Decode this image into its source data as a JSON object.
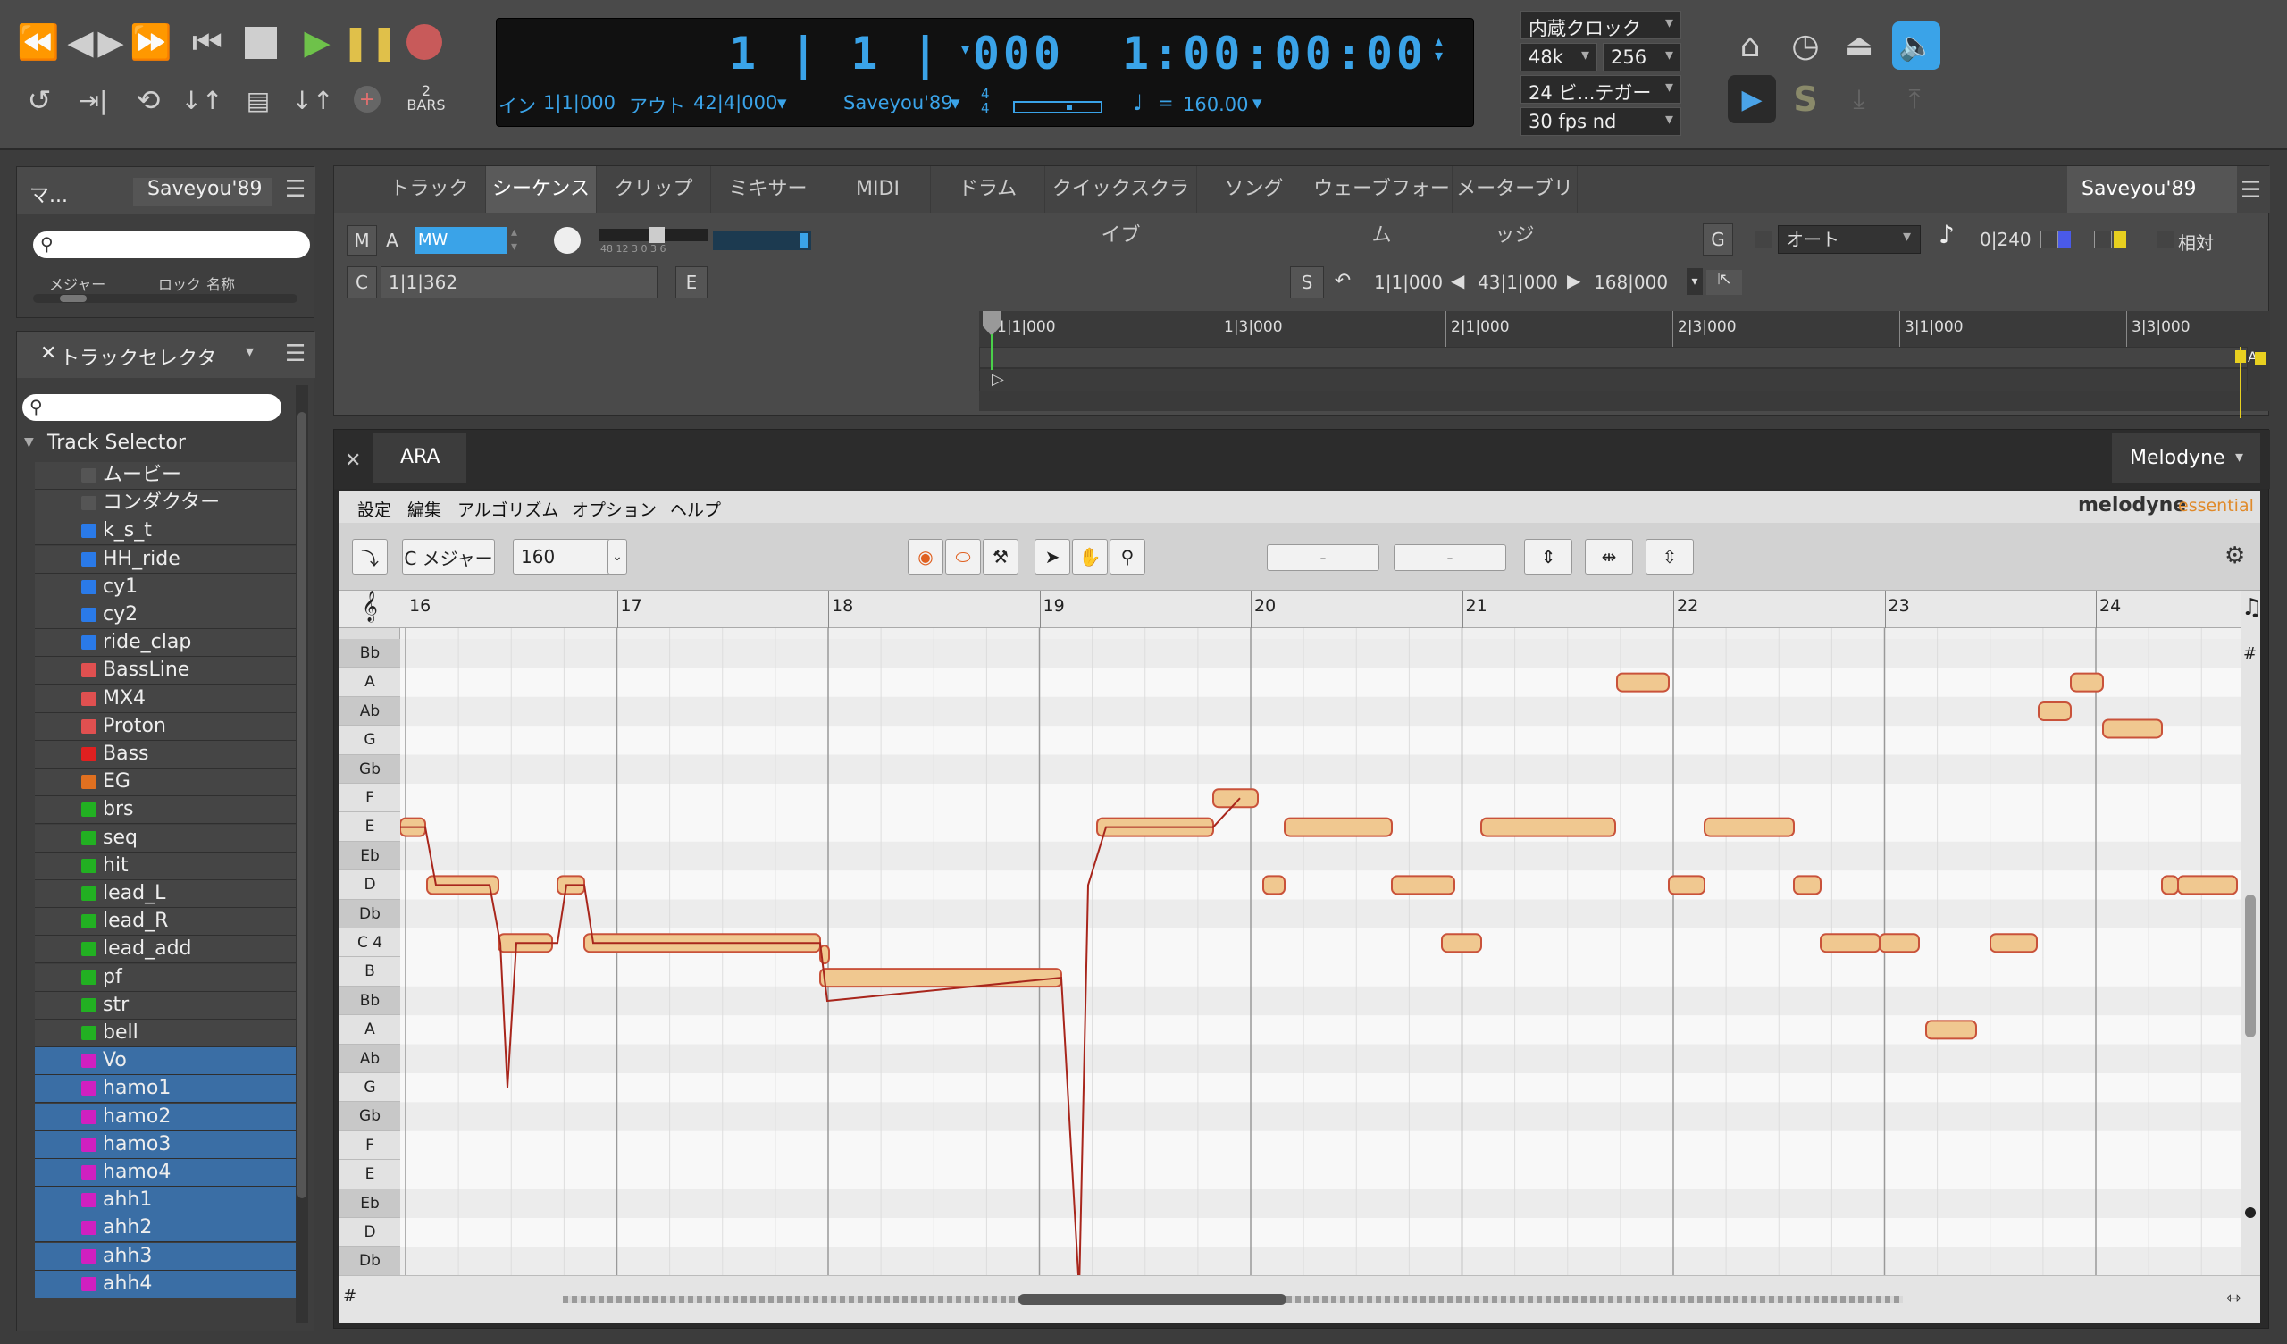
{
  "transport": {
    "bars_label": "2\nBARS",
    "counter_main": "1 | 1 | 000",
    "counter_time": "1:00:00:00",
    "in_label": "イン",
    "in_value": "1|1|000",
    "out_label": "アウト",
    "out_value": "42|4|000",
    "song_name": "Saveyou'89",
    "sig_top": "4",
    "sig_bottom": "4",
    "tempo": "160.00",
    "clock": "内蔵クロック",
    "rate": "48k",
    "buffer": "256",
    "bit": "24 ビ...テガー",
    "fps": "30 fps nd"
  },
  "left_top": {
    "title": "マ...",
    "song": "Saveyou'89",
    "col1": "メジャー",
    "col2": "ロック",
    "col3": "名称"
  },
  "track_selector": {
    "title": "トラックセレクタ",
    "root": "Track Selector",
    "tracks": [
      {
        "name": "ムービー",
        "color": "#555",
        "sel": false
      },
      {
        "name": "コンダクター",
        "color": "#555",
        "sel": false
      },
      {
        "name": "k_s_t",
        "color": "#2a7ae8",
        "sel": false
      },
      {
        "name": "HH_ride",
        "color": "#2a7ae8",
        "sel": false
      },
      {
        "name": "cy1",
        "color": "#2a7ae8",
        "sel": false
      },
      {
        "name": "cy2",
        "color": "#2a7ae8",
        "sel": false
      },
      {
        "name": "ride_clap",
        "color": "#2a7ae8",
        "sel": false
      },
      {
        "name": "BassLine",
        "color": "#e05050",
        "sel": false
      },
      {
        "name": "MX4",
        "color": "#e05050",
        "sel": false
      },
      {
        "name": "Proton",
        "color": "#e05050",
        "sel": false
      },
      {
        "name": "Bass",
        "color": "#e02020",
        "sel": false
      },
      {
        "name": "EG",
        "color": "#e07020",
        "sel": false
      },
      {
        "name": "brs",
        "color": "#22b022",
        "sel": false
      },
      {
        "name": "seq",
        "color": "#22b022",
        "sel": false
      },
      {
        "name": "hit",
        "color": "#22b022",
        "sel": false
      },
      {
        "name": "lead_L",
        "color": "#22b022",
        "sel": false
      },
      {
        "name": "lead_R",
        "color": "#22b022",
        "sel": false
      },
      {
        "name": "lead_add",
        "color": "#22b022",
        "sel": false
      },
      {
        "name": "pf",
        "color": "#22b022",
        "sel": false
      },
      {
        "name": "str",
        "color": "#22b022",
        "sel": false
      },
      {
        "name": "bell",
        "color": "#22b022",
        "sel": false
      },
      {
        "name": "Vo",
        "color": "#d020c0",
        "sel": true
      },
      {
        "name": "hamo1",
        "color": "#d020c0",
        "sel": true
      },
      {
        "name": "hamo2",
        "color": "#d020c0",
        "sel": true
      },
      {
        "name": "hamo3",
        "color": "#d020c0",
        "sel": true
      },
      {
        "name": "hamo4",
        "color": "#d020c0",
        "sel": true
      },
      {
        "name": "ahh1",
        "color": "#d020c0",
        "sel": true
      },
      {
        "name": "ahh2",
        "color": "#d020c0",
        "sel": true
      },
      {
        "name": "ahh3",
        "color": "#d020c0",
        "sel": true
      },
      {
        "name": "ahh4",
        "color": "#d020c0",
        "sel": true
      }
    ]
  },
  "tabs": [
    "トラック",
    "シーケンス",
    "クリップ",
    "ミキサー",
    "MIDI",
    "ドラム",
    "クイックスクライブ",
    "ソング",
    "ウェーブフォーム",
    "メーターブリッジ"
  ],
  "seq": {
    "song": "Saveyou'89",
    "m": "M",
    "a": "A",
    "plugin": "MW Equali...",
    "meter": "48  12  3 0 3 6",
    "c": "C",
    "pos": "1|1|362",
    "e": "E",
    "g": "G",
    "auto": "オート",
    "grid": "0|240",
    "rel": "相対",
    "s": "S",
    "loop_start": "1|1|000",
    "loop_end": "43|1|000",
    "loop_len": "168|000",
    "ruler": [
      "1|1|000",
      "1|3|000",
      "2|1|000",
      "2|3|000",
      "3|1|000",
      "3|3|000"
    ],
    "marker": "A"
  },
  "ara": {
    "title": "ARA",
    "plugin": "Melodyne",
    "menu": [
      "設定",
      "編集",
      "アルゴリズム",
      "オプション",
      "ヘルプ"
    ],
    "logo": "melodyne",
    "logo2": "essential",
    "key": "C メジャー",
    "tempo": "160",
    "f1": "-",
    "f2": "-",
    "bars": [
      "16",
      "17",
      "18",
      "19",
      "20",
      "21",
      "22",
      "23",
      "24"
    ],
    "keys": [
      "Bb",
      "A",
      "Ab",
      "G",
      "Gb",
      "F",
      "E",
      "Eb",
      "D",
      "Db",
      "C 4",
      "B",
      "Bb",
      "A",
      "Ab",
      "G",
      "Gb",
      "F",
      "E",
      "Eb",
      "D",
      "Db"
    ]
  }
}
